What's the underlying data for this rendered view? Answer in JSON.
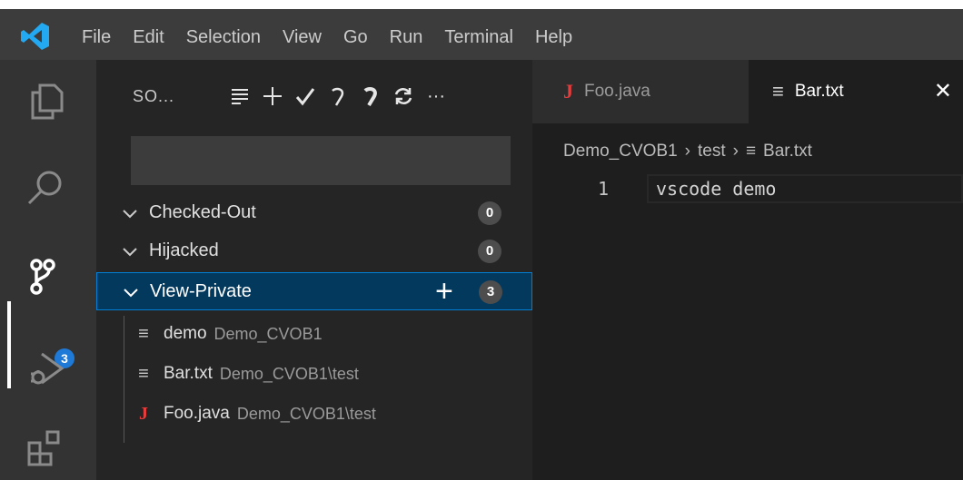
{
  "menu": [
    "File",
    "Edit",
    "Selection",
    "View",
    "Go",
    "Run",
    "Terminal",
    "Help"
  ],
  "activity": {
    "items": [
      "explorer-icon",
      "search-icon",
      "source-control-icon",
      "run-debug-icon",
      "extensions-icon"
    ],
    "source_control_badge": "3"
  },
  "sidebar": {
    "title": "SO...",
    "actions": [
      "list-icon",
      "add-icon",
      "check-icon",
      "undo-icon",
      "undo-all-icon",
      "refresh-icon",
      "more-icon"
    ],
    "more_label": "···",
    "message_placeholder": "",
    "groups": [
      {
        "label": "Checked-Out",
        "count": "0"
      },
      {
        "label": "Hijacked",
        "count": "0"
      },
      {
        "label": "View-Private",
        "count": "3"
      }
    ],
    "files": [
      {
        "name": "demo",
        "path": "Demo_CVOB1",
        "icon": "text-file-icon"
      },
      {
        "name": "Bar.txt",
        "path": "Demo_CVOB1\\test",
        "icon": "text-file-icon"
      },
      {
        "name": "Foo.java",
        "path": "Demo_CVOB1\\test",
        "icon": "java-icon"
      }
    ]
  },
  "editor": {
    "tabs": [
      {
        "label": "Foo.java",
        "icon": "J"
      },
      {
        "label": "Bar.txt",
        "icon": "≡"
      }
    ],
    "breadcrumb": [
      "Demo_CVOB1",
      "test",
      "Bar.txt"
    ],
    "lines": [
      {
        "number": "1",
        "text": "vscode demo"
      }
    ]
  },
  "colors": {
    "accent": "#007fd4",
    "badge": "#1f79d6",
    "java": "#e83b3b",
    "selected_row": "#04395e"
  }
}
